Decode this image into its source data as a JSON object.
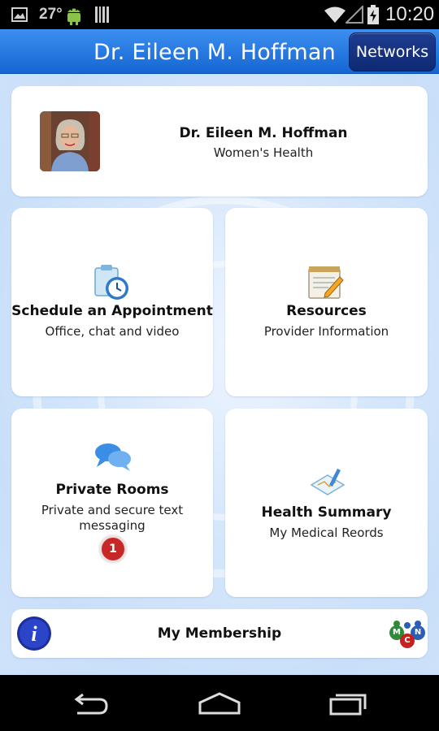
{
  "status_bar": {
    "temperature": "27°",
    "time": "10:20",
    "icons": [
      "image-icon",
      "android-icon",
      "barcode-icon",
      "wifi-icon",
      "signal-icon",
      "battery-charging-icon"
    ]
  },
  "header": {
    "title": "Dr. Eileen M. Hoffman",
    "networks_label": "Networks",
    "accent_color": "#1f74e0"
  },
  "profile": {
    "name": "Dr. Eileen M. Hoffman",
    "specialty": "Women's Health"
  },
  "tiles": {
    "schedule": {
      "title": "Schedule an Appointment",
      "subtitle": "Office, chat and video",
      "icon": "clipboard-clock-icon"
    },
    "resources": {
      "title": "Resources",
      "subtitle": "Provider Information",
      "icon": "notepad-pencil-icon"
    },
    "private_rooms": {
      "title": "Private Rooms",
      "subtitle_line1": "Private and secure text",
      "subtitle_line2": "messaging",
      "badge_count": "1",
      "icon": "chat-bubbles-icon"
    },
    "health_summary": {
      "title": "Health Summary",
      "subtitle": "My Medical Reords",
      "icon": "chart-pen-icon"
    }
  },
  "membership": {
    "label": "My Membership",
    "info_icon": "info-icon",
    "logo_letters": [
      "M",
      "C",
      "N"
    ]
  },
  "nav_bar": {
    "icons": [
      "back-icon",
      "home-icon",
      "recents-icon"
    ]
  }
}
